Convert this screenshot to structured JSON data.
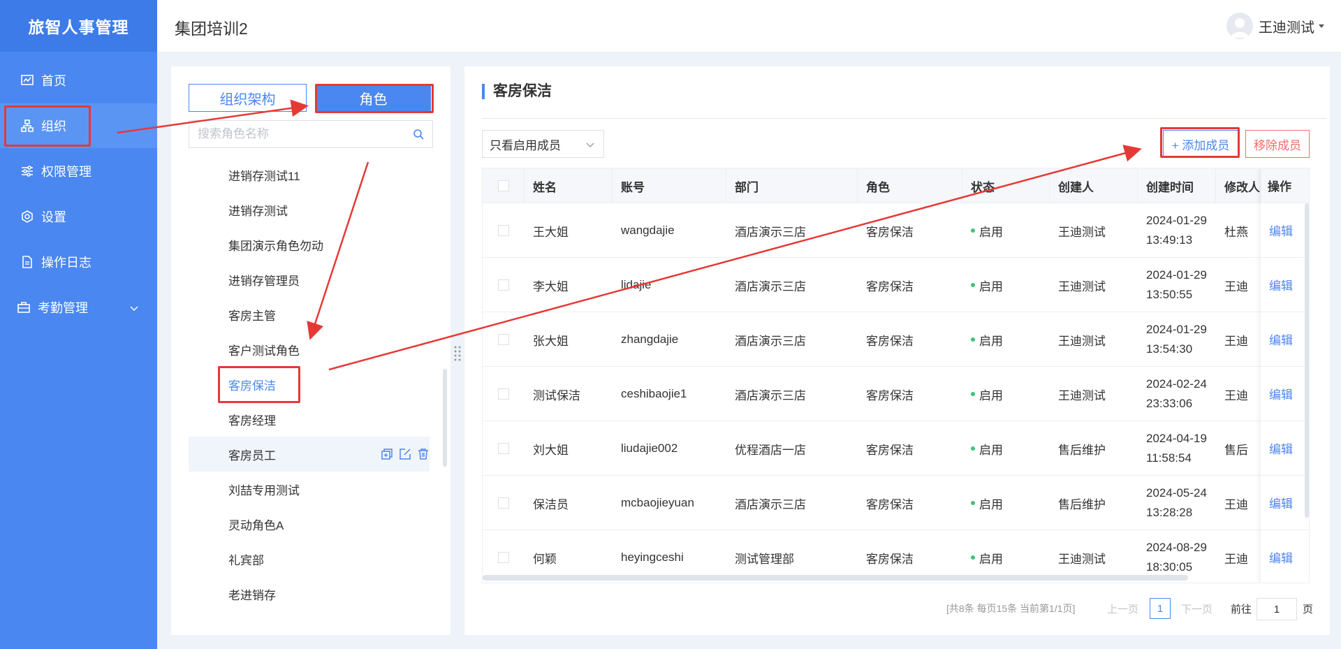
{
  "app": {
    "brand": "旅智人事管理",
    "page_title": "集团培训2",
    "user_name": "王迪测试"
  },
  "sidebar": {
    "items": [
      {
        "label": "首页",
        "icon": "chart-icon"
      },
      {
        "label": "组织",
        "icon": "org-icon",
        "active": true
      },
      {
        "label": "权限管理",
        "icon": "sliders-icon"
      },
      {
        "label": "设置",
        "icon": "settings-icon"
      },
      {
        "label": "操作日志",
        "icon": "document-icon"
      },
      {
        "label": "考勤管理",
        "icon": "briefcase-icon",
        "expandable": true
      }
    ]
  },
  "left_panel": {
    "tab_org": "组织架构",
    "tab_role": "角色",
    "search_placeholder": "搜索角色名称",
    "roles": [
      "进销存测试11",
      "进销存测试",
      "集团演示角色勿动",
      "进销存管理员",
      "客房主管",
      "客户测试角色",
      "客房保洁",
      "客房经理",
      "客房员工",
      "刘喆专用测试",
      "灵动角色A",
      "礼宾部",
      "老进销存"
    ],
    "selected_role": "客房保洁",
    "hovered_role": "客房员工"
  },
  "main": {
    "title": "客房保洁",
    "filter_value": "只看启用成员",
    "add_button": "+ 添加成员",
    "remove_button": "移除成员",
    "columns": [
      "姓名",
      "账号",
      "部门",
      "角色",
      "状态",
      "创建人",
      "创建时间",
      "修改人",
      "操作"
    ],
    "rows": [
      {
        "name": "王大姐",
        "account": "wangdajie",
        "dept": "酒店演示三店",
        "role": "客房保洁",
        "status": "启用",
        "creator": "王迪测试",
        "date": "2024-01-29",
        "time": "13:49:13",
        "modifier": "杜燕"
      },
      {
        "name": "李大姐",
        "account": "lidajie",
        "dept": "酒店演示三店",
        "role": "客房保洁",
        "status": "启用",
        "creator": "王迪测试",
        "date": "2024-01-29",
        "time": "13:50:55",
        "modifier": "王迪"
      },
      {
        "name": "张大姐",
        "account": "zhangdajie",
        "dept": "酒店演示三店",
        "role": "客房保洁",
        "status": "启用",
        "creator": "王迪测试",
        "date": "2024-01-29",
        "time": "13:54:30",
        "modifier": "王迪"
      },
      {
        "name": "测试保洁",
        "account": "ceshibaojie1",
        "dept": "酒店演示三店",
        "role": "客房保洁",
        "status": "启用",
        "creator": "王迪测试",
        "date": "2024-02-24",
        "time": "23:33:06",
        "modifier": "王迪"
      },
      {
        "name": "刘大姐",
        "account": "liudajie002",
        "dept": "优程酒店一店",
        "role": "客房保洁",
        "status": "启用",
        "creator": "售后维护",
        "date": "2024-04-19",
        "time": "11:58:54",
        "modifier": "售后"
      },
      {
        "name": "保洁员",
        "account": "mcbaojieyuan",
        "dept": "酒店演示三店",
        "role": "客房保洁",
        "status": "启用",
        "creator": "售后维护",
        "date": "2024-05-24",
        "time": "13:28:28",
        "modifier": "王迪"
      },
      {
        "name": "何颖",
        "account": "heyingceshi",
        "dept": "测试管理部",
        "role": "客房保洁",
        "status": "启用",
        "creator": "王迪测试",
        "date": "2024-08-29",
        "time": "18:30:05",
        "modifier": "王迪"
      }
    ],
    "edit_label": "编辑",
    "pager": {
      "info": "[共8条 每页15条 当前第1/1页]",
      "prev": "上一页",
      "page": "1",
      "next": "下一页",
      "goto": "前往",
      "goto_value": "1",
      "unit": "页"
    }
  },
  "colors": {
    "primary": "#4a87f0",
    "danger": "#f56c6c",
    "annotation": "#e53935",
    "status_on": "#3cc37a"
  }
}
